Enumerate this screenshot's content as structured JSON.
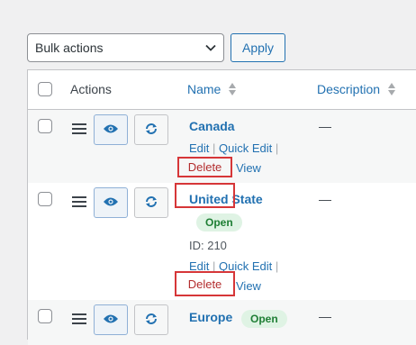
{
  "bulk": {
    "selected": "Bulk actions",
    "apply_label": "Apply"
  },
  "table": {
    "headers": {
      "actions": "Actions",
      "name": "Name",
      "description": "Description"
    },
    "rows": [
      {
        "name": "Canada",
        "description": "—",
        "actions": {
          "edit": "Edit",
          "sep1": "|",
          "quick_edit": "Quick Edit",
          "sep2": "|",
          "delete": "Delete",
          "view": "View"
        }
      },
      {
        "name": "United State",
        "description": "—",
        "status": "Open",
        "id_text": "ID: 210",
        "actions": {
          "edit": "Edit",
          "sep1": "|",
          "quick_edit": "Quick Edit",
          "sep2": "|",
          "delete": "Delete",
          "view": "View"
        }
      },
      {
        "name": "Europe",
        "description": "—",
        "status": "Open"
      }
    ]
  },
  "icons": {
    "drag": "hamburger-icon",
    "view": "eye-icon",
    "sync": "refresh-icon",
    "sort": "sort-arrows-icon",
    "dropdown": "chevron-down-icon"
  },
  "colors": {
    "link": "#2271b1",
    "delete": "#b32d2e",
    "highlight_box": "#d63638",
    "badge_bg": "#dff3e4",
    "badge_text": "#1e7e34"
  }
}
